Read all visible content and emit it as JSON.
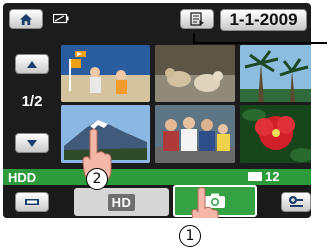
{
  "top_bar": {
    "home_icon": "home-icon",
    "battery_icon": "battery-icon",
    "playlist_icon": "playlist-icon",
    "date": "1-1-2009"
  },
  "navigation": {
    "up_icon": "up-arrow-icon",
    "page": "1/2",
    "down_icon": "down-arrow-icon"
  },
  "thumbnails": [
    {
      "icon": "video-thumbnail-1"
    },
    {
      "icon": "video-thumbnail-2"
    },
    {
      "icon": "video-thumbnail-3"
    },
    {
      "icon": "video-thumbnail-4",
      "selected": true
    },
    {
      "icon": "video-thumbnail-5"
    },
    {
      "icon": "video-thumbnail-6"
    }
  ],
  "status_bar": {
    "media": "HDD",
    "remaining": "12"
  },
  "bottom_bar": {
    "viewfinder_icon": "viewfinder-icon",
    "hd_tab": "HD",
    "camera_icon": "camera-icon",
    "options_icon": "options-icon"
  },
  "callouts": {
    "one": "1",
    "two": "2"
  },
  "colors": {
    "status_bar": "#2d9a3c",
    "selected_border": "#8eb7e4",
    "screen_bg": "#1c1c1c"
  }
}
